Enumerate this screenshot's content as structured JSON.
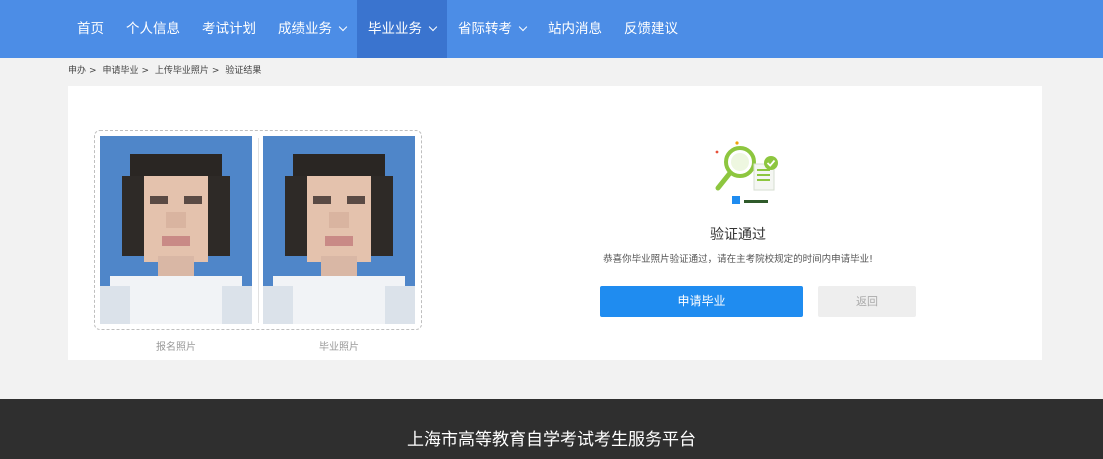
{
  "nav": {
    "items": [
      {
        "label": "首页",
        "dropdown": false
      },
      {
        "label": "个人信息",
        "dropdown": false
      },
      {
        "label": "考试计划",
        "dropdown": false
      },
      {
        "label": "成绩业务",
        "dropdown": true
      },
      {
        "label": "毕业业务",
        "dropdown": true,
        "active": true
      },
      {
        "label": "省际转考",
        "dropdown": true
      },
      {
        "label": "站内消息",
        "dropdown": false
      },
      {
        "label": "反馈建议",
        "dropdown": false
      }
    ]
  },
  "breadcrumb": {
    "items": [
      "申办",
      "申请毕业",
      "上传毕业照片",
      "验证结果"
    ],
    "separator": ">"
  },
  "photos": {
    "left_caption": "报名照片",
    "right_caption": "毕业照片"
  },
  "result": {
    "title": "验证通过",
    "message": "恭喜你毕业照片验证通过，请在主考院校规定的时间内申请毕业!",
    "apply_label": "申请毕业",
    "back_label": "返回"
  },
  "footer": {
    "title": "上海市高等教育自学考试考生服务平台"
  },
  "colors": {
    "nav_bg": "#4c8de6",
    "nav_active": "#3a74cf",
    "primary_button": "#1f8cf0",
    "footer_bg": "#2f2f2f",
    "success_green": "#8dc63f"
  }
}
